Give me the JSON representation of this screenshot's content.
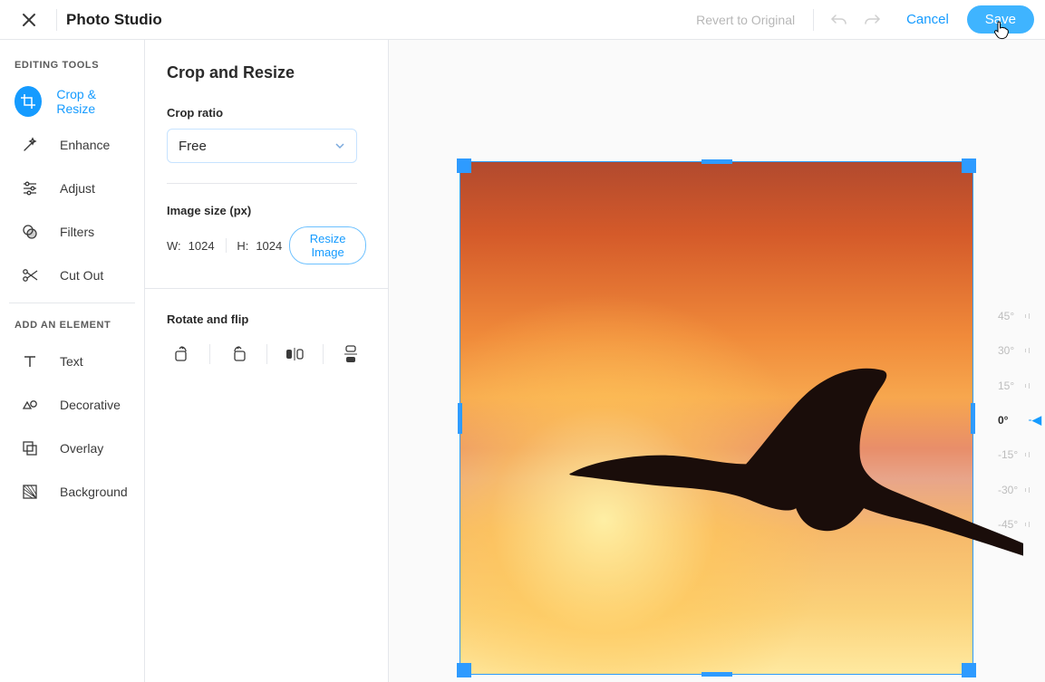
{
  "header": {
    "title": "Photo Studio",
    "revert": "Revert to Original",
    "cancel": "Cancel",
    "save": "Save"
  },
  "sidebar": {
    "section1": "EDITING TOOLS",
    "items1": [
      {
        "label": "Crop & Resize",
        "active": true,
        "icon": "crop-icon"
      },
      {
        "label": "Enhance",
        "active": false,
        "icon": "wand-icon"
      },
      {
        "label": "Adjust",
        "active": false,
        "icon": "sliders-icon"
      },
      {
        "label": "Filters",
        "active": false,
        "icon": "filters-icon"
      },
      {
        "label": "Cut Out",
        "active": false,
        "icon": "scissors-icon"
      }
    ],
    "section2": "ADD AN ELEMENT",
    "items2": [
      {
        "label": "Text",
        "icon": "text-icon"
      },
      {
        "label": "Decorative",
        "icon": "shapes-icon"
      },
      {
        "label": "Overlay",
        "icon": "overlay-icon"
      },
      {
        "label": "Background",
        "icon": "pattern-icon"
      }
    ]
  },
  "panel": {
    "title": "Crop and Resize",
    "crop_ratio_label": "Crop ratio",
    "crop_ratio_value": "Free",
    "image_size_label": "Image size (px)",
    "width_label": "W:",
    "width_val": "1024",
    "height_label": "H:",
    "height_val": "1024",
    "resize_btn": "Resize Image",
    "rotate_label": "Rotate and flip"
  },
  "rotation": {
    "steps": [
      "45°",
      "30°",
      "15°",
      "0°",
      "-15°",
      "-30°",
      "-45°"
    ],
    "current": "0°"
  }
}
